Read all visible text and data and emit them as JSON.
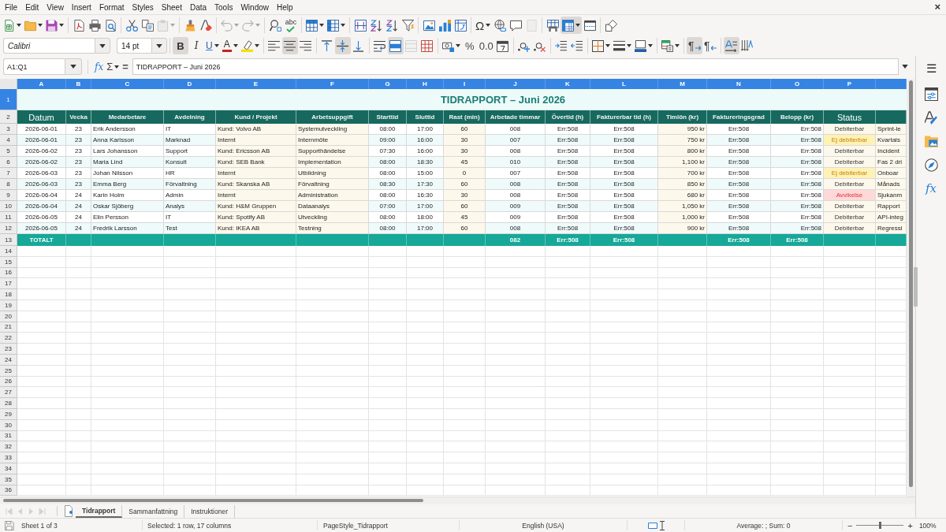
{
  "menu_bar": {
    "items": [
      "File",
      "Edit",
      "View",
      "Insert",
      "Format",
      "Styles",
      "Sheet",
      "Data",
      "Tools",
      "Window",
      "Help"
    ],
    "close": "×"
  },
  "standard_toolbar": [
    {
      "on": false,
      "disabled": false
    },
    {
      "on": false,
      "disabled": false
    },
    {
      "on": false,
      "disabled": false
    },
    {
      "on": false,
      "disabled": false
    },
    {
      "on": false,
      "disabled": false
    },
    {
      "on": false,
      "disabled": false
    },
    {
      "on": false,
      "disabled": false
    },
    {
      "on": false,
      "disabled": false
    },
    {
      "on": false,
      "disabled": true
    },
    {
      "on": false,
      "disabled": false
    },
    {
      "on": false,
      "disabled": false
    },
    {
      "on": false,
      "disabled": true
    },
    {
      "on": false,
      "disabled": true
    },
    {
      "on": false,
      "disabled": false
    },
    {
      "glyph": "abc",
      "on": false,
      "disabled": false
    },
    {
      "on": false,
      "disabled": false
    },
    {
      "on": false,
      "disabled": false
    },
    {
      "on": false,
      "disabled": false
    },
    {
      "on": false,
      "disabled": false
    },
    {
      "on": false,
      "disabled": false
    },
    {
      "on": false,
      "disabled": false
    },
    {
      "on": false,
      "disabled": false
    },
    {
      "on": false,
      "disabled": false
    },
    {
      "on": false,
      "disabled": false
    },
    {
      "glyph": "Ω",
      "on": false,
      "disabled": false
    },
    {
      "on": false,
      "disabled": false
    },
    {
      "on": false,
      "disabled": false
    },
    {
      "on": false,
      "disabled": true
    },
    {
      "on": false,
      "disabled": false
    },
    {
      "on": true,
      "disabled": false
    },
    {
      "on": false,
      "disabled": false
    },
    {
      "on": false,
      "disabled": false
    }
  ],
  "formatting_toolbar": {
    "font_name": "Calibri",
    "font_size": "14 pt",
    "buttons": [
      {
        "glyph": "B",
        "on": true,
        "disabled": false
      },
      {
        "glyph": "I",
        "on": false,
        "disabled": false
      },
      {
        "glyph": "U",
        "on": false,
        "disabled": false
      },
      {
        "glyph": "A",
        "on": false,
        "disabled": false
      },
      {
        "on": false,
        "disabled": false
      },
      {
        "on": false,
        "disabled": false
      },
      {
        "on": true,
        "disabled": false
      },
      {
        "on": false,
        "disabled": false
      },
      {
        "on": false,
        "disabled": false
      },
      {
        "on": true,
        "disabled": false
      },
      {
        "on": false,
        "disabled": false
      },
      {
        "on": false,
        "disabled": false
      },
      {
        "on": true,
        "disabled": false
      },
      {
        "on": false,
        "disabled": true
      },
      {
        "on": false,
        "disabled": false
      },
      {
        "on": false,
        "disabled": false
      },
      {
        "glyph": "%",
        "on": false,
        "disabled": false
      },
      {
        "glyph": "0.0",
        "on": false,
        "disabled": false
      },
      {
        "on": false,
        "disabled": false
      },
      {
        "on": false,
        "disabled": false
      },
      {
        "on": false,
        "disabled": false
      },
      {
        "on": false,
        "disabled": false
      },
      {
        "on": false,
        "disabled": false
      },
      {
        "on": false,
        "disabled": false
      },
      {
        "on": false,
        "disabled": false
      },
      {
        "on": false,
        "disabled": false
      },
      {
        "on": false,
        "disabled": false
      },
      {
        "glyph": "¶",
        "on": true,
        "disabled": false
      },
      {
        "glyph": "¶",
        "on": false,
        "disabled": false
      },
      {
        "on": true,
        "disabled": false
      },
      {
        "on": false,
        "disabled": false
      }
    ]
  },
  "formula_bar": {
    "name_box": "A1:Q1",
    "function_wizard": "fx",
    "sum": "Σ",
    "equals": "=",
    "content": "TIDRAPPORT – Juni 2026"
  },
  "sidebar": {
    "menu": "☰",
    "functions": "fx"
  },
  "sheet": {
    "column_headers": [
      {
        "label": "A",
        "selected": true
      },
      {
        "label": "B",
        "selected": true
      },
      {
        "label": "C",
        "selected": true
      },
      {
        "label": "D",
        "selected": true
      },
      {
        "label": "E",
        "selected": true
      },
      {
        "label": "F",
        "selected": true
      },
      {
        "label": "G",
        "selected": true
      },
      {
        "label": "H",
        "selected": true
      },
      {
        "label": "I",
        "selected": true
      },
      {
        "label": "J",
        "selected": true
      },
      {
        "label": "K",
        "selected": true
      },
      {
        "label": "L",
        "selected": true
      },
      {
        "label": "M",
        "selected": true
      },
      {
        "label": "N",
        "selected": true
      },
      {
        "label": "O",
        "selected": true
      },
      {
        "label": "P",
        "selected": true
      },
      {
        "selected": true
      }
    ],
    "row_headers": [
      {
        "label": "1",
        "selected": true
      },
      {
        "label": "2",
        "selected": false
      },
      {
        "label": "3",
        "selected": false
      },
      {
        "label": "4",
        "selected": false
      },
      {
        "label": "5",
        "selected": false
      },
      {
        "label": "6",
        "selected": false
      },
      {
        "label": "7",
        "selected": false
      },
      {
        "label": "8",
        "selected": false
      },
      {
        "label": "9",
        "selected": false
      },
      {
        "label": "10",
        "selected": false
      },
      {
        "label": "11",
        "selected": false
      },
      {
        "label": "12",
        "selected": false
      },
      {
        "label": "13",
        "selected": false
      },
      {
        "label": "14",
        "selected": false
      },
      {
        "label": "15",
        "selected": false
      },
      {
        "label": "16",
        "selected": false
      },
      {
        "label": "17",
        "selected": false
      },
      {
        "label": "18",
        "selected": false
      },
      {
        "label": "19",
        "selected": false
      },
      {
        "label": "20",
        "selected": false
      },
      {
        "label": "21",
        "selected": false
      },
      {
        "label": "22",
        "selected": false
      },
      {
        "label": "23",
        "selected": false
      },
      {
        "label": "24",
        "selected": false
      },
      {
        "label": "25",
        "selected": false
      },
      {
        "label": "26",
        "selected": false
      },
      {
        "label": "27",
        "selected": false
      },
      {
        "label": "28",
        "selected": false
      },
      {
        "label": "29",
        "selected": false
      },
      {
        "label": "30",
        "selected": false
      },
      {
        "label": "31",
        "selected": false
      },
      {
        "label": "32",
        "selected": false
      },
      {
        "label": "33",
        "selected": false
      },
      {
        "label": "34",
        "selected": false
      },
      {
        "label": "35",
        "selected": false
      },
      {
        "label": "36",
        "selected": false
      }
    ],
    "title": "TIDRAPPORT – Juni 2026",
    "columns": [
      "Datum",
      "Vecka",
      "Medarbetare",
      "Avdelning",
      "Kund / Projekt",
      "Arbetsuppgift",
      "Starttid",
      "Sluttid",
      "Rast (min)",
      "Arbetade timmar",
      "Övertid (h)",
      "Fakturerbar tid (h)",
      "Timlön (kr)",
      "Faktureringsgrad",
      "Belopp (kr)",
      "Status"
    ],
    "rows": [
      {
        "date": "2026-06-01",
        "week": "23",
        "employee": "Erik Andersson",
        "department": "IT",
        "client_project": "Kund: Volvo AB",
        "task": "Systemutveckling",
        "start": "08:00",
        "end": "17:00",
        "break_min": "60",
        "hours_worked": "008",
        "overtime_h": "Err:508",
        "billable_time_h": "Err:508",
        "hourly_rate": "950 kr",
        "billing_rate": "Err:508",
        "amount": "Err:508",
        "status": {
          "text": "Debiterbar",
          "kind": "billable"
        },
        "column_q": "Sprint-le"
      },
      {
        "date": "2026-06-01",
        "week": "23",
        "employee": "Anna Karlsson",
        "department": "Marknad",
        "client_project": "Internt",
        "task": "Internmöte",
        "start": "09:00",
        "end": "16:00",
        "break_min": "30",
        "hours_worked": "007",
        "overtime_h": "Err:508",
        "billable_time_h": "Err:508",
        "hourly_rate": "750 kr",
        "billing_rate": "Err:508",
        "amount": "Err:508",
        "status": {
          "text": "Ej debiterbar",
          "kind": "nonbillable"
        },
        "column_q": "Kvartals"
      },
      {
        "date": "2026-06-02",
        "week": "23",
        "employee": "Lars Johansson",
        "department": "Support",
        "client_project": "Kund: Ericsson AB",
        "task": "Supporthändelse",
        "start": "07:30",
        "end": "16:00",
        "break_min": "30",
        "hours_worked": "008",
        "overtime_h": "Err:508",
        "billable_time_h": "Err:508",
        "hourly_rate": "800 kr",
        "billing_rate": "Err:508",
        "amount": "Err:508",
        "status": {
          "text": "Debiterbar",
          "kind": "billable"
        },
        "column_q": "Incident"
      },
      {
        "date": "2026-06-02",
        "week": "23",
        "employee": "Maria Lind",
        "department": "Konsult",
        "client_project": "Kund: SEB Bank",
        "task": "Implementation",
        "start": "08:00",
        "end": "18:30",
        "break_min": "45",
        "hours_worked": "010",
        "overtime_h": "Err:508",
        "billable_time_h": "Err:508",
        "hourly_rate": "1,100 kr",
        "billing_rate": "Err:508",
        "amount": "Err:508",
        "status": {
          "text": "Debiterbar",
          "kind": "billable"
        },
        "column_q": "Fas 2 dri"
      },
      {
        "date": "2026-06-03",
        "week": "23",
        "employee": "Johan Nilsson",
        "department": "HR",
        "client_project": "Internt",
        "task": "Utbildning",
        "start": "08:00",
        "end": "15:00",
        "break_min": "0",
        "hours_worked": "007",
        "overtime_h": "Err:508",
        "billable_time_h": "Err:508",
        "hourly_rate": "700 kr",
        "billing_rate": "Err:508",
        "amount": "Err:508",
        "status": {
          "text": "Ej debiterbar",
          "kind": "nonbillable"
        },
        "column_q": "Onboar"
      },
      {
        "date": "2026-06-03",
        "week": "23",
        "employee": "Emma Berg",
        "department": "Förvaltning",
        "client_project": "Kund: Skanska AB",
        "task": "Förvaltning",
        "start": "08:30",
        "end": "17:30",
        "break_min": "60",
        "hours_worked": "008",
        "overtime_h": "Err:508",
        "billable_time_h": "Err:508",
        "hourly_rate": "850 kr",
        "billing_rate": "Err:508",
        "amount": "Err:508",
        "status": {
          "text": "Debiterbar",
          "kind": "billable"
        },
        "column_q": "Månads"
      },
      {
        "date": "2026-06-04",
        "week": "24",
        "employee": "Karin Holm",
        "department": "Admin",
        "client_project": "Internt",
        "task": "Administration",
        "start": "08:00",
        "end": "16:30",
        "break_min": "30",
        "hours_worked": "008",
        "overtime_h": "Err:508",
        "billable_time_h": "Err:508",
        "hourly_rate": "680 kr",
        "billing_rate": "Err:508",
        "amount": "Err:508",
        "status": {
          "text": "Avvikelse",
          "kind": "deviation"
        },
        "column_q": "Sjukanm"
      },
      {
        "date": "2026-06-04",
        "week": "24",
        "employee": "Oskar Sjöberg",
        "department": "Analys",
        "client_project": "Kund: H&M Gruppen",
        "task": "Dataanalys",
        "start": "07:00",
        "end": "17:00",
        "break_min": "60",
        "hours_worked": "009",
        "overtime_h": "Err:508",
        "billable_time_h": "Err:508",
        "hourly_rate": "1,050 kr",
        "billing_rate": "Err:508",
        "amount": "Err:508",
        "status": {
          "text": "Debiterbar",
          "kind": "billable"
        },
        "column_q": "Rapport"
      },
      {
        "date": "2026-06-05",
        "week": "24",
        "employee": "Elin Persson",
        "department": "IT",
        "client_project": "Kund: Spotify AB",
        "task": "Utveckling",
        "start": "08:00",
        "end": "18:00",
        "break_min": "45",
        "hours_worked": "009",
        "overtime_h": "Err:508",
        "billable_time_h": "Err:508",
        "hourly_rate": "1,000 kr",
        "billing_rate": "Err:508",
        "amount": "Err:508",
        "status": {
          "text": "Debiterbar",
          "kind": "billable"
        },
        "column_q": "API-integ"
      },
      {
        "date": "2026-06-05",
        "week": "24",
        "employee": "Fredrik Larsson",
        "department": "Test",
        "client_project": "Kund: IKEA AB",
        "task": "Testning",
        "start": "08:00",
        "end": "17:00",
        "break_min": "60",
        "hours_worked": "008",
        "overtime_h": "Err:508",
        "billable_time_h": "Err:508",
        "hourly_rate": "900 kr",
        "billing_rate": "Err:508",
        "amount": "Err:508",
        "status": {
          "text": "Debiterbar",
          "kind": "billable"
        },
        "column_q": "Regressi"
      }
    ],
    "totals": {
      "label": "TOTALT",
      "hours_worked": "082",
      "overtime_h": "Err:508",
      "billable_time_h": "Err:508",
      "billing_rate": "Err:508",
      "amount": "Err:508"
    }
  },
  "sheet_tabs": {
    "nav_buttons": [
      {
        "disabled": true
      },
      {
        "disabled": true
      },
      {
        "disabled": true
      },
      {
        "disabled": true
      }
    ],
    "tabs": [
      {
        "label": "Tidrapport",
        "selected": true
      },
      {
        "label": "Sammanfattning",
        "selected": false
      },
      {
        "label": "Instruktioner",
        "selected": false
      }
    ]
  },
  "status_bar": {
    "sheet_position": "Sheet 1 of 3",
    "selection": "Selected: 1 row, 17 columns",
    "page_style": "PageStyle_Tidrapport",
    "language": "English (USA)",
    "summary": "Average: ; Sum: 0",
    "zoom": {
      "minus": "−",
      "plus": "+",
      "level": 0.5,
      "reading": "100%"
    }
  }
}
